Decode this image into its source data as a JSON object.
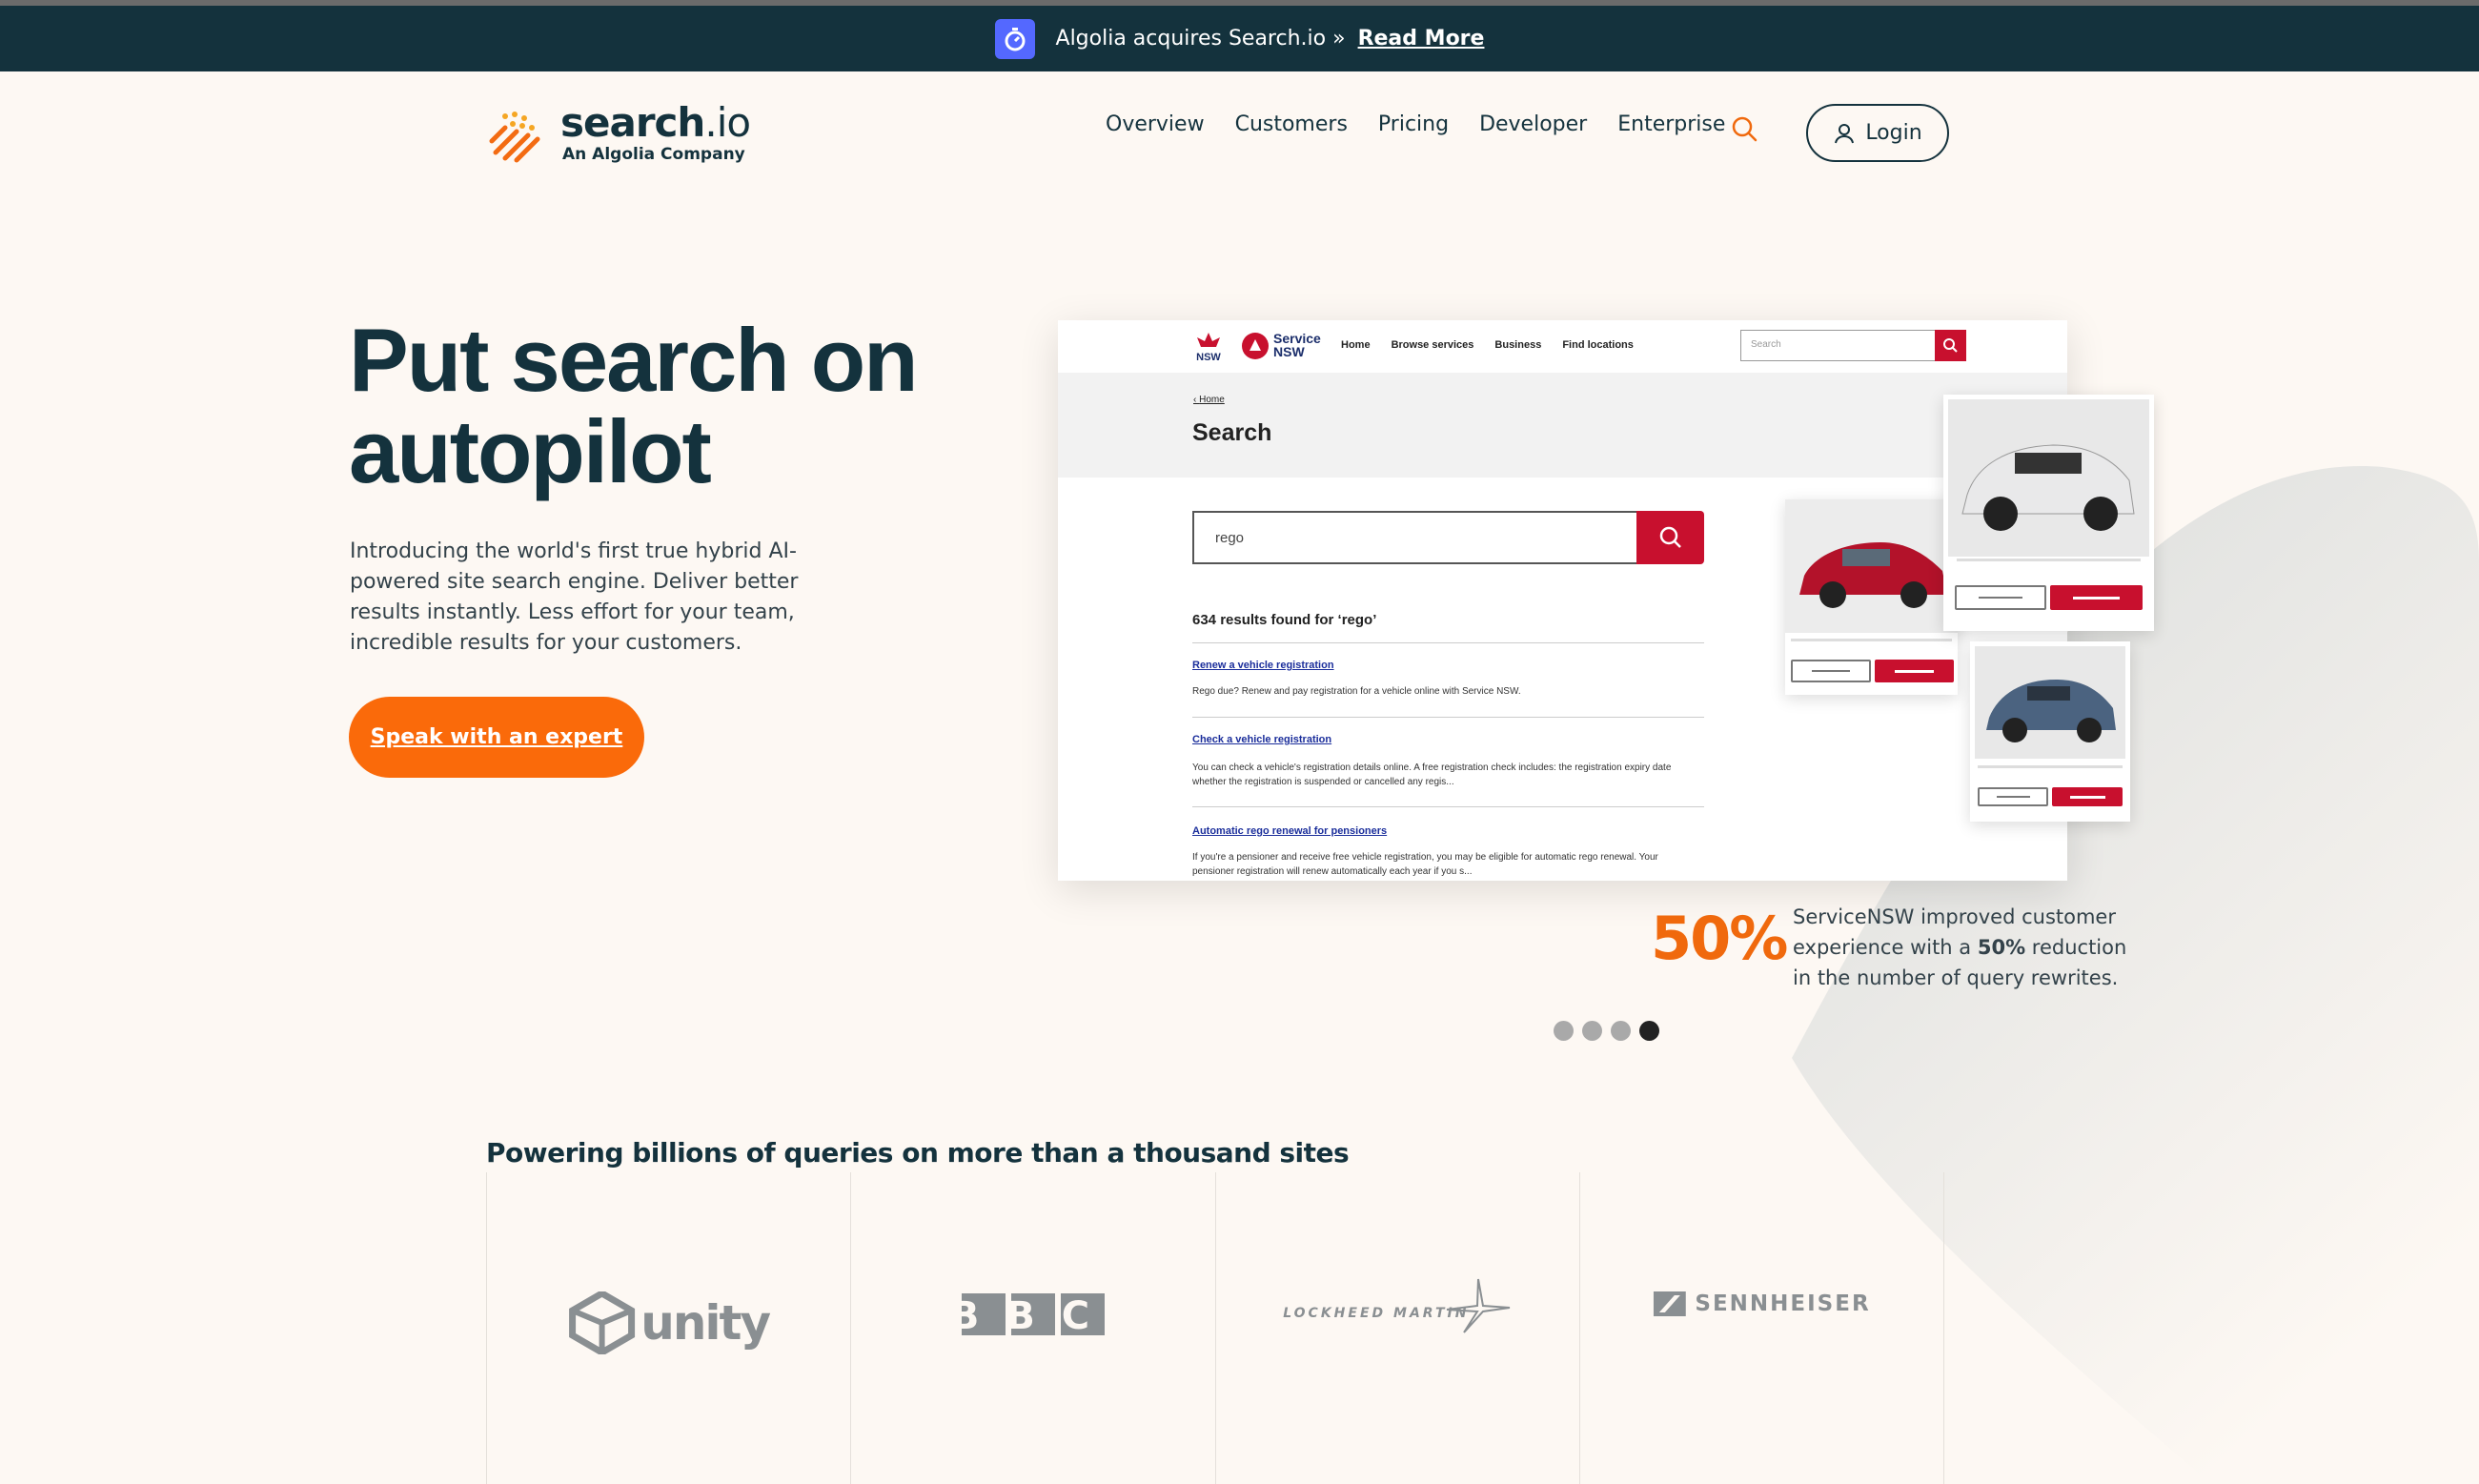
{
  "announcement": {
    "text": "Algolia acquires Search.io »",
    "link": "Read More"
  },
  "header": {
    "logo_word": "search",
    "logo_word_suffix": ".io",
    "logo_sub": "An Algolia Company",
    "nav": [
      "Overview",
      "Customers",
      "Pricing",
      "Developer",
      "Enterprise"
    ],
    "login_label": "Login"
  },
  "hero": {
    "title_line1": "Put search on",
    "title_line2": "autopilot",
    "description": "Introducing the world's first true hybrid AI-powered site search engine. Deliver better results instantly. Less effort for your team, incredible results for your customers.",
    "cta_label": "Speak with an expert"
  },
  "mock": {
    "svc_line1": "Service",
    "svc_line2": "NSW",
    "nsw_label": "NSW",
    "nav": [
      "Home",
      "Browse services",
      "Business",
      "Find locations"
    ],
    "search_placeholder": "Search",
    "breadcrumb": "Home",
    "title": "Search",
    "query": "rego",
    "results_count": "634 results found for ‘rego’",
    "results": [
      {
        "title": "Renew a vehicle registration",
        "text": "Rego due? Renew and pay registration for a vehicle online with Service NSW."
      },
      {
        "title": "Check a vehicle registration",
        "text": "You can check a vehicle's registration details online. A free registration check includes: the registration expiry date whether the registration is suspended or cancelled any regis..."
      },
      {
        "title": "Automatic rego renewal for pensioners",
        "text": "If you're a pensioner and receive free vehicle registration, you may be eligible for automatic rego renewal. Your pensioner registration will renew automatically each year if you s..."
      }
    ]
  },
  "stat": {
    "number": "50%",
    "text_before": "ServiceNSW improved customer experience with a ",
    "text_bold": "50%",
    "text_after": " reduction in the number of query rewrites."
  },
  "carousel": {
    "total": 4,
    "active": 4
  },
  "logos": {
    "heading": "Powering billions of queries on more than a thousand sites",
    "brands": [
      "unity",
      "BBC",
      "LOCKHEED MARTIN",
      "SENNHEISER"
    ]
  },
  "colors": {
    "accent": "#fa6a0a",
    "navy": "#14323d",
    "announce_bg": "#14323d",
    "nsw_red": "#c8102e",
    "algolia_blue": "#5468ff"
  }
}
